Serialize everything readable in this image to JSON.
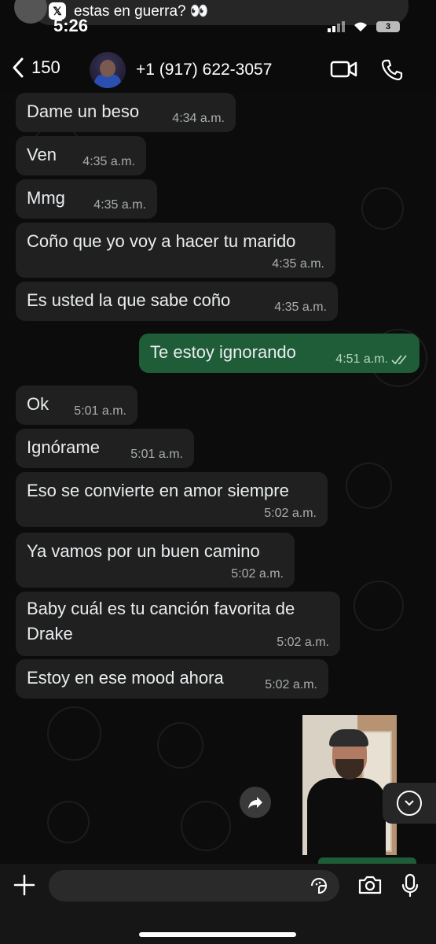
{
  "notification": {
    "text": "estas en guerra? 👀",
    "badge": "𝕏"
  },
  "status_bar": {
    "time": "5:26",
    "battery": "3"
  },
  "header": {
    "back_count": "150",
    "contact": "+1 (917) 622-3057"
  },
  "messages": [
    {
      "text": "Dame un beso",
      "time": "4:34 a.m.",
      "dir": "in"
    },
    {
      "text": "Ven",
      "time": "4:35 a.m.",
      "dir": "in"
    },
    {
      "text": "Mmg",
      "time": "4:35 a.m.",
      "dir": "in"
    },
    {
      "text": "Coño que yo voy a hacer tu marido",
      "time": "4:35 a.m.",
      "dir": "in"
    },
    {
      "text": "Es usted la que sabe coño",
      "time": "4:35 a.m.",
      "dir": "in"
    },
    {
      "text": "Te estoy ignorando",
      "time": "4:51 a.m.",
      "dir": "out"
    },
    {
      "text": "Ok",
      "time": "5:01 a.m.",
      "dir": "in"
    },
    {
      "text": "Ignórame",
      "time": "5:01 a.m.",
      "dir": "in"
    },
    {
      "text": "Eso se convierte en amor siempre",
      "time": "5:02 a.m.",
      "dir": "in"
    },
    {
      "text": "Ya vamos por un buen camino",
      "time": "5:02 a.m.",
      "dir": "in"
    },
    {
      "text": "Baby cuál es tu canción favorita de",
      "text2": "Drake",
      "time": "5:02 a.m.",
      "dir": "in"
    },
    {
      "text": "Estoy en ese mood ahora",
      "time": "5:02 a.m.",
      "dir": "in"
    }
  ],
  "composer": {
    "placeholder": ""
  }
}
